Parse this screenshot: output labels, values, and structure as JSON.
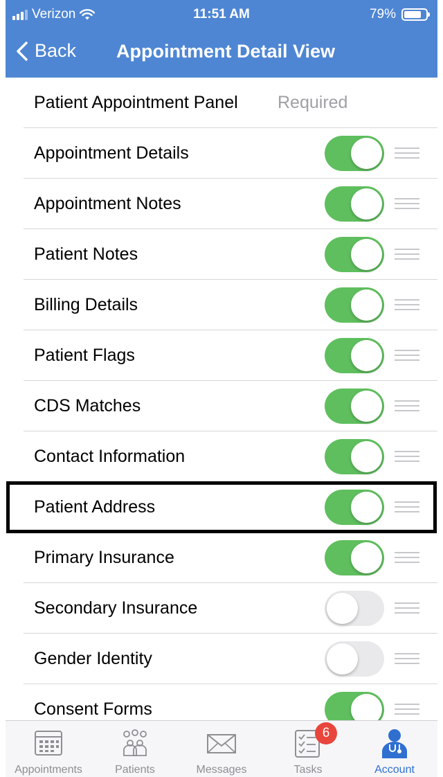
{
  "status_bar": {
    "carrier": "Verizon",
    "time": "11:51 AM",
    "battery": "79%",
    "battery_level": 0.79
  },
  "nav": {
    "back_label": "Back",
    "title": "Appointment Detail View"
  },
  "list": {
    "rows": [
      {
        "label": "Patient Appointment Panel",
        "required_text": "Required"
      },
      {
        "label": "Appointment Details",
        "enabled": true
      },
      {
        "label": "Appointment Notes",
        "enabled": true
      },
      {
        "label": "Patient Notes",
        "enabled": true
      },
      {
        "label": "Billing Details",
        "enabled": true
      },
      {
        "label": "Patient Flags",
        "enabled": true
      },
      {
        "label": "CDS Matches",
        "enabled": true
      },
      {
        "label": "Contact Information",
        "enabled": true
      },
      {
        "label": "Patient Address",
        "enabled": true,
        "highlighted": true
      },
      {
        "label": "Primary Insurance",
        "enabled": true
      },
      {
        "label": "Secondary Insurance",
        "enabled": false
      },
      {
        "label": "Gender Identity",
        "enabled": false
      },
      {
        "label": "Consent Forms",
        "enabled": true
      }
    ]
  },
  "tab_bar": {
    "tabs": [
      {
        "label": "Appointments",
        "icon": "calendar-icon"
      },
      {
        "label": "Patients",
        "icon": "patients-icon"
      },
      {
        "label": "Messages",
        "icon": "envelope-icon"
      },
      {
        "label": "Tasks",
        "icon": "checklist-icon",
        "badge": "6"
      },
      {
        "label": "Account",
        "icon": "doctor-icon",
        "active": true
      }
    ]
  },
  "colors": {
    "header": "#4e86d3",
    "toggle_on": "#5fbf5e",
    "toggle_off": "#e9e9eb",
    "tab_active": "#2f6fd0",
    "badge": "#e8453c"
  }
}
